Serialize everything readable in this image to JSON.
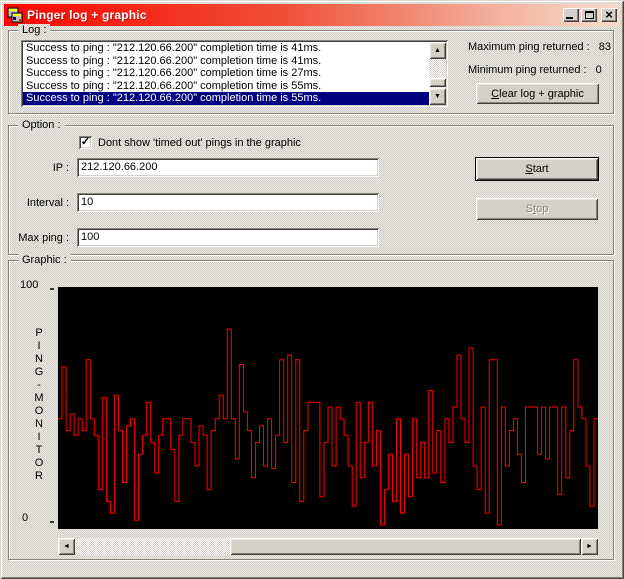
{
  "window": {
    "title": "Pinger log + graphic",
    "close_glyph": "×"
  },
  "colors": {
    "titlebar_left": "#fb0500",
    "titlebar_right": "#f7dccd",
    "selection": "#000080",
    "chart_bg": "#000000",
    "chart_line": "#ff0000",
    "button_face": "#d4d0c8"
  },
  "glyphs": {
    "check": "✓",
    "up": "▲",
    "down": "▼",
    "left": "◄",
    "right": "►"
  },
  "log": {
    "group_label": "Log :",
    "entries": [
      "Success to ping : \"212.120.66.200\" completion time is 41ms.",
      "Success to ping : \"212.120.66.200\" completion time is 41ms.",
      "Success to ping : \"212.120.66.200\" completion time is 27ms.",
      "Success to ping : \"212.120.66.200\" completion time is 55ms.",
      "Success to ping : \"212.120.66.200\" completion time is 55ms."
    ],
    "selected_index": 4,
    "max_label": "Maximum ping returned :",
    "max_value": "83",
    "min_label": "Minimum ping returned :",
    "min_value": "0",
    "clear_button": {
      "pre": "",
      "key": "C",
      "post": "lear log + graphic"
    }
  },
  "option": {
    "group_label": "Option :",
    "checkbox": {
      "checked": true,
      "label": "Dont show 'timed out' pings in the graphic"
    },
    "fields": [
      {
        "label": "IP :",
        "value": "212.120.66.200"
      },
      {
        "label": "Interval :",
        "value": "10"
      },
      {
        "label": "Max ping :",
        "value": "100"
      }
    ],
    "start_button": {
      "pre": "",
      "key": "S",
      "post": "tart",
      "enabled": true
    },
    "stop_button": {
      "pre": "S",
      "key": "t",
      "post": "op",
      "enabled": false
    }
  },
  "graphic": {
    "group_label": "Graphic :",
    "y_max": "100",
    "y_min": "0",
    "vertical_label": "PING-MONITOR"
  },
  "chart_data": {
    "type": "line",
    "interpolation": "step",
    "title": "",
    "xlabel": "",
    "ylabel": "PING-MONITOR",
    "ylim": [
      0,
      100
    ],
    "y_ticks": [
      0,
      100
    ],
    "grid": false,
    "legend": false,
    "line_color": "#ff0000",
    "background": "#000000",
    "values": [
      45,
      67,
      40,
      47,
      38,
      45,
      40,
      70,
      45,
      38,
      15,
      54,
      10,
      5,
      55,
      40,
      18,
      42,
      45,
      2,
      30,
      38,
      52,
      35,
      22,
      38,
      45,
      45,
      32,
      10,
      38,
      45,
      45,
      35,
      25,
      42,
      38,
      15,
      40,
      45,
      55,
      45,
      83,
      45,
      28,
      68,
      48,
      40,
      20,
      35,
      42,
      25,
      45,
      24,
      38,
      70,
      35,
      72,
      18,
      70,
      10,
      40,
      52,
      52,
      52,
      12,
      35,
      50,
      25,
      50,
      45,
      38,
      25,
      8,
      52,
      20,
      35,
      52,
      25,
      40,
      0,
      15,
      30,
      10,
      45,
      5,
      30,
      12,
      45,
      20,
      35,
      20,
      57,
      22,
      40,
      18,
      45,
      35,
      50,
      72,
      45,
      35,
      75,
      25,
      15,
      50,
      5,
      70,
      70,
      0,
      50,
      25,
      40,
      45,
      30,
      18,
      50,
      50,
      50,
      30,
      50,
      28,
      50,
      50,
      13,
      50,
      20,
      40,
      70,
      50,
      45,
      25,
      8,
      45
    ]
  }
}
